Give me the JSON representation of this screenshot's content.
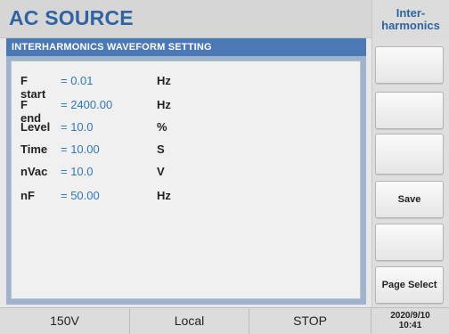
{
  "header": {
    "title": "AC SOURCE",
    "mode_line1": "Inter-",
    "mode_line2": "harmonics"
  },
  "panel": {
    "title": "INTERHARMONICS WAVEFORM SETTING",
    "params": [
      {
        "label": "F start",
        "value": "= 0.01",
        "unit": "Hz"
      },
      {
        "label": "F end",
        "value": "= 2400.00",
        "unit": "Hz"
      },
      {
        "label": "Level",
        "value": "= 10.0",
        "unit": "%"
      },
      {
        "label": "Time",
        "value": "= 10.00",
        "unit": "S"
      },
      {
        "label": "nVac",
        "value": "= 10.0",
        "unit": "V"
      },
      {
        "label": "nF",
        "value": "= 50.00",
        "unit": "Hz"
      }
    ]
  },
  "softkeys": [
    "",
    "",
    "",
    "Save",
    "",
    "Page Select"
  ],
  "status": {
    "range": "150V",
    "control": "Local",
    "output": "STOP",
    "date": "2020/9/10",
    "time": "10:41"
  }
}
